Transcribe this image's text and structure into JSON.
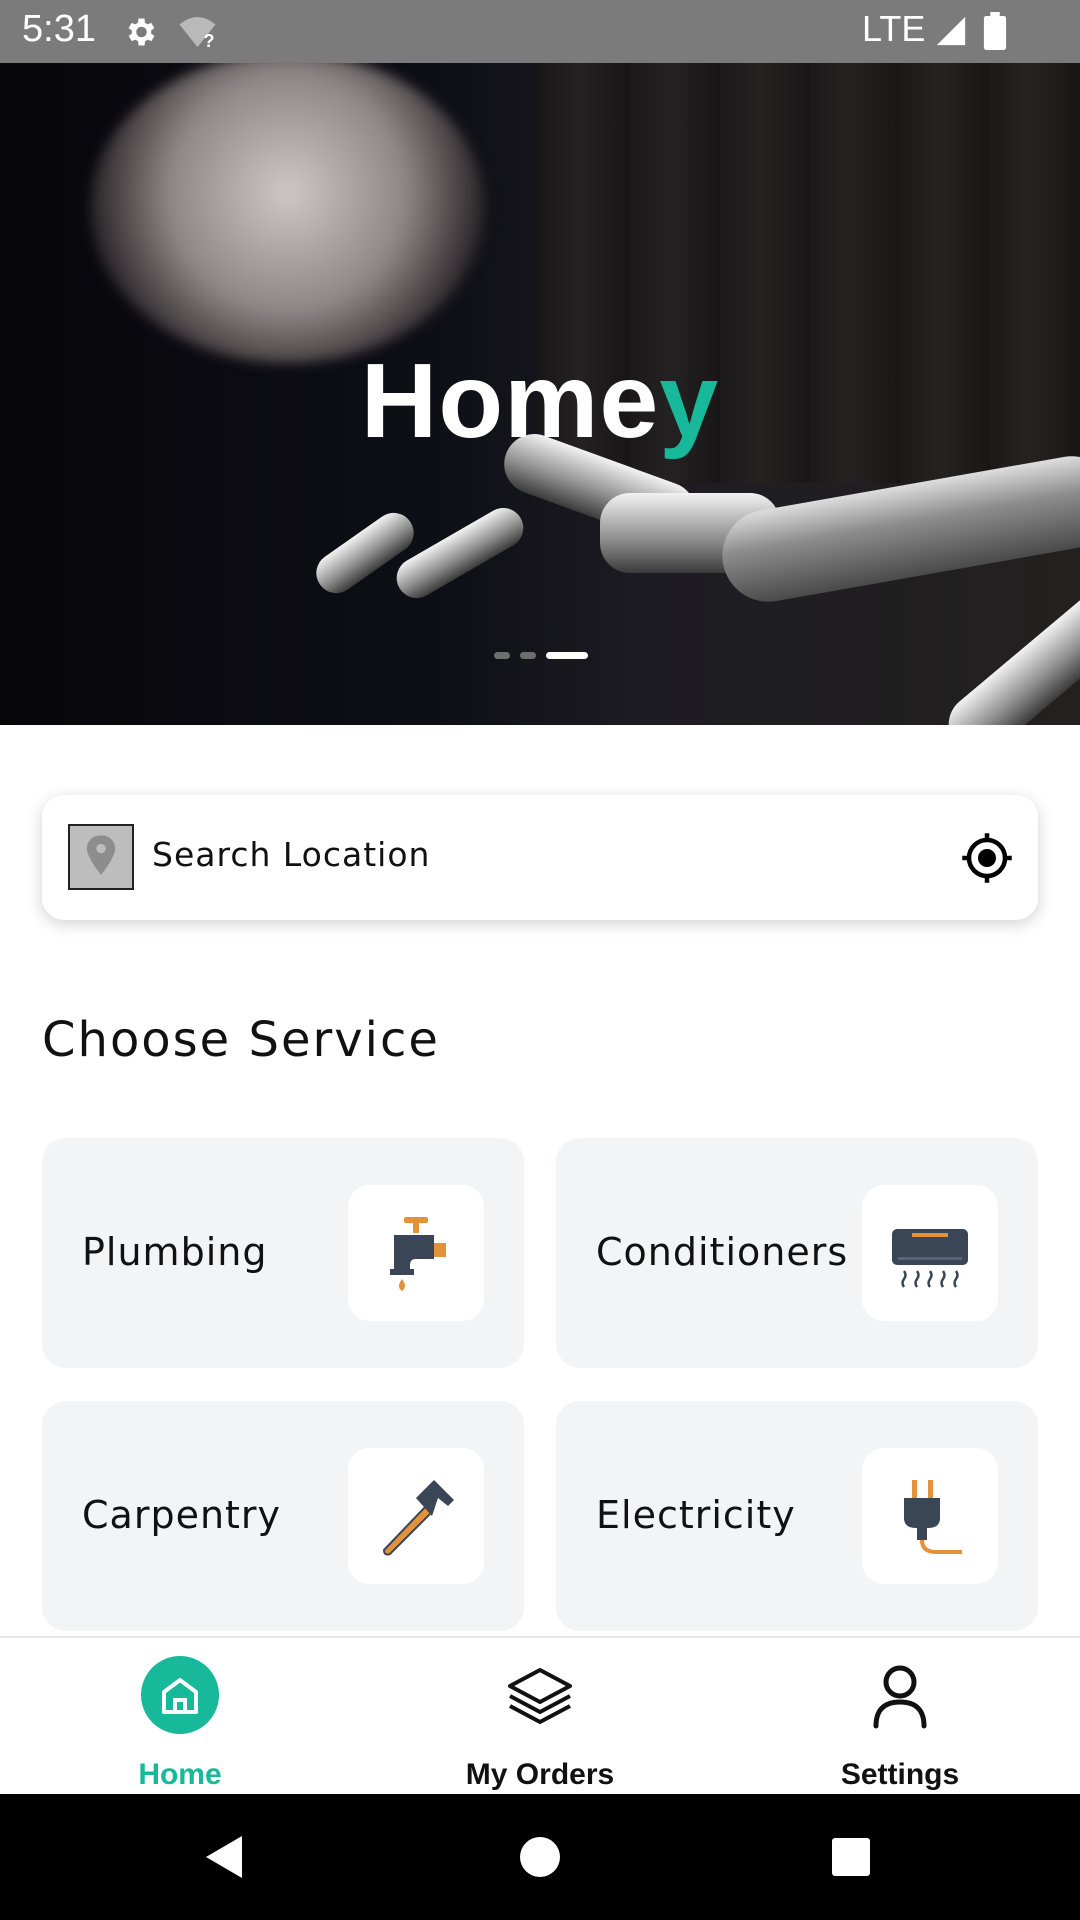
{
  "status_bar": {
    "time": "5:31",
    "network": "LTE",
    "icons": [
      "gear-icon",
      "wifi-question-icon",
      "signal-icon",
      "battery-icon"
    ]
  },
  "hero": {
    "title_main": "Home",
    "title_accent": "y",
    "accent_color": "#18b89a",
    "carousel_total": 3,
    "carousel_active_index": 2
  },
  "search": {
    "placeholder": "Search Location",
    "icons": [
      "location-pin-icon",
      "gps-target-icon"
    ]
  },
  "section_title": "Choose Service",
  "services": [
    {
      "label": "Plumbing",
      "icon": "faucet-icon"
    },
    {
      "label": "Conditioners",
      "icon": "air-conditioner-icon"
    },
    {
      "label": "Carpentry",
      "icon": "hammer-icon"
    },
    {
      "label": "Electricity",
      "icon": "plug-icon"
    }
  ],
  "bottom_nav": [
    {
      "label": "Home",
      "icon": "home-icon",
      "active": true
    },
    {
      "label": "My Orders",
      "icon": "layers-icon",
      "active": false
    },
    {
      "label": "Settings",
      "icon": "user-icon",
      "active": false
    }
  ],
  "system_nav": [
    "back-icon",
    "home-circle-icon",
    "recents-icon"
  ]
}
